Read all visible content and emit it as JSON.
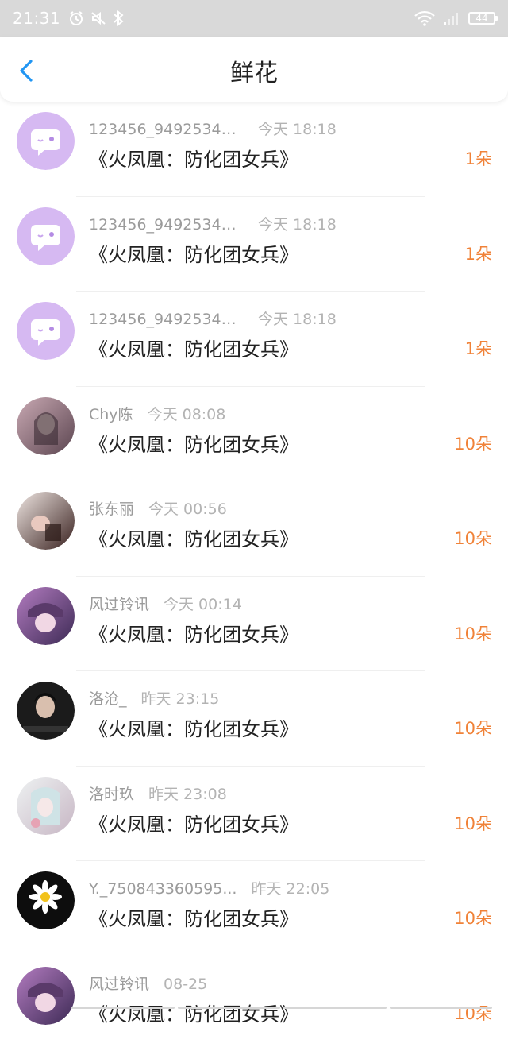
{
  "status_bar": {
    "time": "21:31",
    "battery": "44",
    "icons": [
      "alarm-icon",
      "mute-icon",
      "bluetooth-icon",
      "wifi-icon",
      "signal-icon",
      "battery-icon"
    ]
  },
  "header": {
    "title": "鲜花",
    "back_icon": "chevron-left-icon"
  },
  "colors": {
    "accent_orange": "#f08238",
    "back_blue": "#2196f3",
    "default_avatar_bg": "#d6b9f2"
  },
  "gifts": [
    {
      "name": "123456_94925344...",
      "time": "今天 18:18",
      "book": "《火凤凰：防化团女兵》",
      "count": "1朵",
      "avatar": "default-chat-avatar"
    },
    {
      "name": "123456_94925344...",
      "time": "今天 18:18",
      "book": "《火凤凰：防化团女兵》",
      "count": "1朵",
      "avatar": "default-chat-avatar"
    },
    {
      "name": "123456_94925344...",
      "time": "今天 18:18",
      "book": "《火凤凰：防化团女兵》",
      "count": "1朵",
      "avatar": "default-chat-avatar"
    },
    {
      "name": "Chy陈",
      "time": "今天 08:08",
      "book": "《火凤凰：防化团女兵》",
      "count": "10朵",
      "avatar": "user-photo"
    },
    {
      "name": "张东丽",
      "time": "今天 00:56",
      "book": "《火凤凰：防化团女兵》",
      "count": "10朵",
      "avatar": "user-photo"
    },
    {
      "name": "风过铃讯",
      "time": "今天 00:14",
      "book": "《火凤凰：防化团女兵》",
      "count": "10朵",
      "avatar": "user-photo"
    },
    {
      "name": "洛沧_",
      "time": "昨天 23:15",
      "book": "《火凤凰：防化团女兵》",
      "count": "10朵",
      "avatar": "user-photo"
    },
    {
      "name": "洛时玖",
      "time": "昨天 23:08",
      "book": "《火凤凰：防化团女兵》",
      "count": "10朵",
      "avatar": "user-photo"
    },
    {
      "name": "Y._750843360595...",
      "time": "昨天 22:05",
      "book": "《火凤凰：防化团女兵》",
      "count": "10朵",
      "avatar": "daisy-photo"
    },
    {
      "name": "风过铃讯",
      "time": "08-25",
      "book": "《火凤凰：防化团女兵》",
      "count": "10朵",
      "avatar": "user-photo"
    }
  ]
}
